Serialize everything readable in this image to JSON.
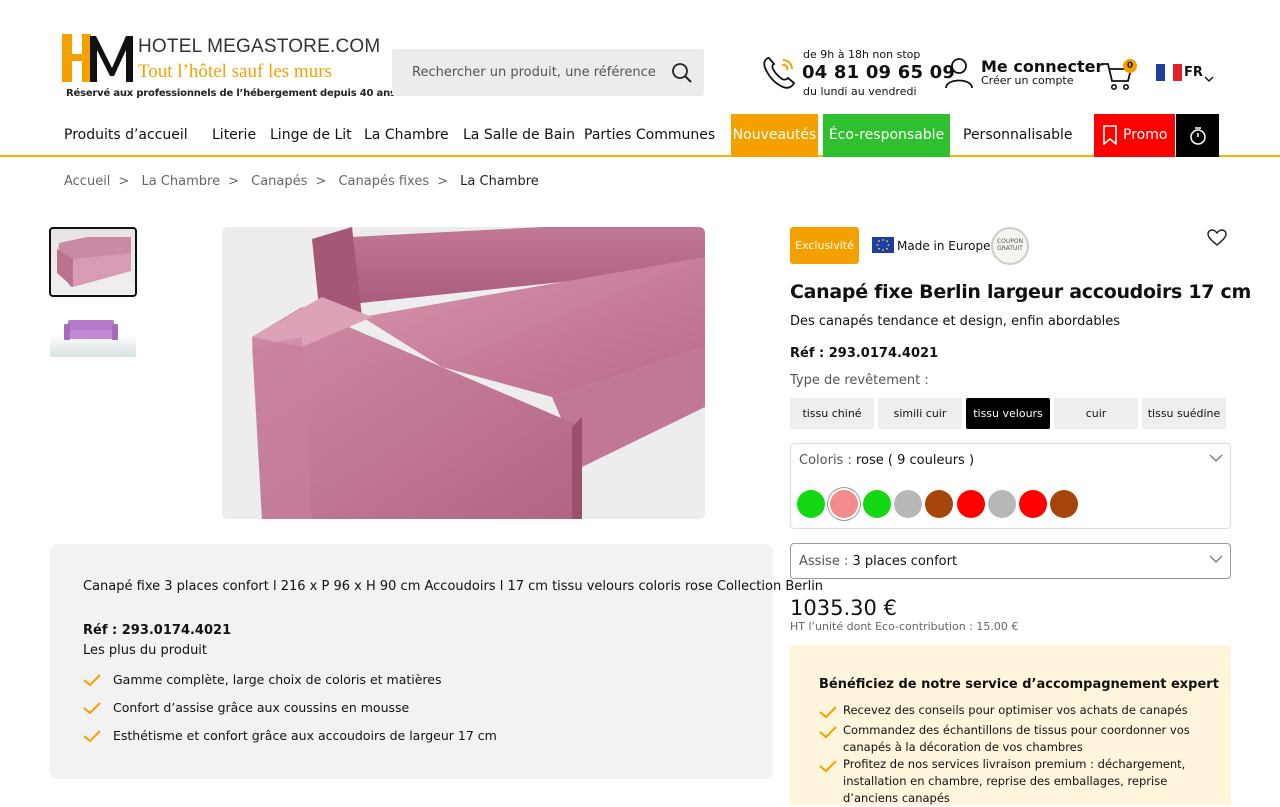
{
  "header": {
    "logo_letters": "HM",
    "logo_title": "HOTEL MEGASTORE.COM",
    "logo_slogan": "Tout l’hôtel sauf les murs",
    "logo_subtitle": "Réservé aux professionnels de l’hébergement depuis 40 ans",
    "search_placeholder": "Rechercher un produit, une référence",
    "phone_hours": "de 9h à 18h non stop",
    "phone_number": "04 81 09 65 09",
    "phone_days": "du lundi au vendredi",
    "login_label": "Me connecter",
    "login_sub": "Créer un compte",
    "cart_count": "0",
    "language": "FR"
  },
  "nav": {
    "items": [
      "Produits d’accueil",
      "Literie",
      "Linge de Lit",
      "La Chambre",
      "La Salle de Bain",
      "Parties Communes",
      "Nouveautés",
      "Éco-responsable",
      "Personnalisable",
      "Promo"
    ],
    "colors": {
      "nouveautes": "#f4a100",
      "eco": "#2fc02f",
      "promo": "#ff0000",
      "timer": "#000000"
    }
  },
  "breadcrumb": [
    "Accueil",
    "La Chambre",
    "Canapés",
    "Canapés fixes",
    "La Chambre"
  ],
  "product": {
    "badge_exclusive": "Exclusivité",
    "made_in": "Made in Europe",
    "coupon_text": "COUPON GRATUIT",
    "title": "Canapé fixe Berlin largeur accoudoirs 17 cm",
    "subtitle": "Des canapés tendance et design, enfin abordables",
    "ref": "Réf : 293.0174.4021",
    "revetement_label": "Type de revêtement :",
    "revetement_options": [
      "tissu chiné",
      "simili cuir",
      "tissu velours",
      "cuir",
      "tissu suédine"
    ],
    "revetement_selected": "tissu velours",
    "coloris_prefix": "Coloris : ",
    "coloris_value": "rose ( 9 couleurs )",
    "swatches": [
      "#13d813",
      "#f38b8b",
      "#13d813",
      "#b8b8b8",
      "#a64509",
      "#ff0000",
      "#b8b8b8",
      "#ff0000",
      "#a64509"
    ],
    "swatch_selected_index": 1,
    "assise_prefix": "Assise : ",
    "assise_value": "3 places confort",
    "price": "1035.30 €",
    "price_sub": "HT l’unité dont Eco-contribution : 15.00 €"
  },
  "description": {
    "title": "Canapé fixe 3 places confort l 216 x P 96 x H 90 cm Accoudoirs l 17 cm tissu velours coloris rose Collection Berlin",
    "ref": "Réf : 293.0174.4021",
    "plus_title": "Les plus du produit",
    "plus": [
      "Gamme complète, large choix de coloris et matières",
      "Confort d’assise grâce aux coussins en mousse",
      "Esthétisme et confort grâce aux accoudoirs de largeur 17 cm"
    ]
  },
  "expert": {
    "title": "Bénéficiez de notre service d’accompagnement expert",
    "items": [
      "Recevez des conseils pour optimiser vos achats de canapés",
      "Commandez des échantillons de tissus pour coordonner vos canapés à la décoration de vos chambres",
      "Profitez de nos services livraison premium : déchargement, installation en chambre, reprise des emballages, reprise d’anciens canapés"
    ]
  }
}
